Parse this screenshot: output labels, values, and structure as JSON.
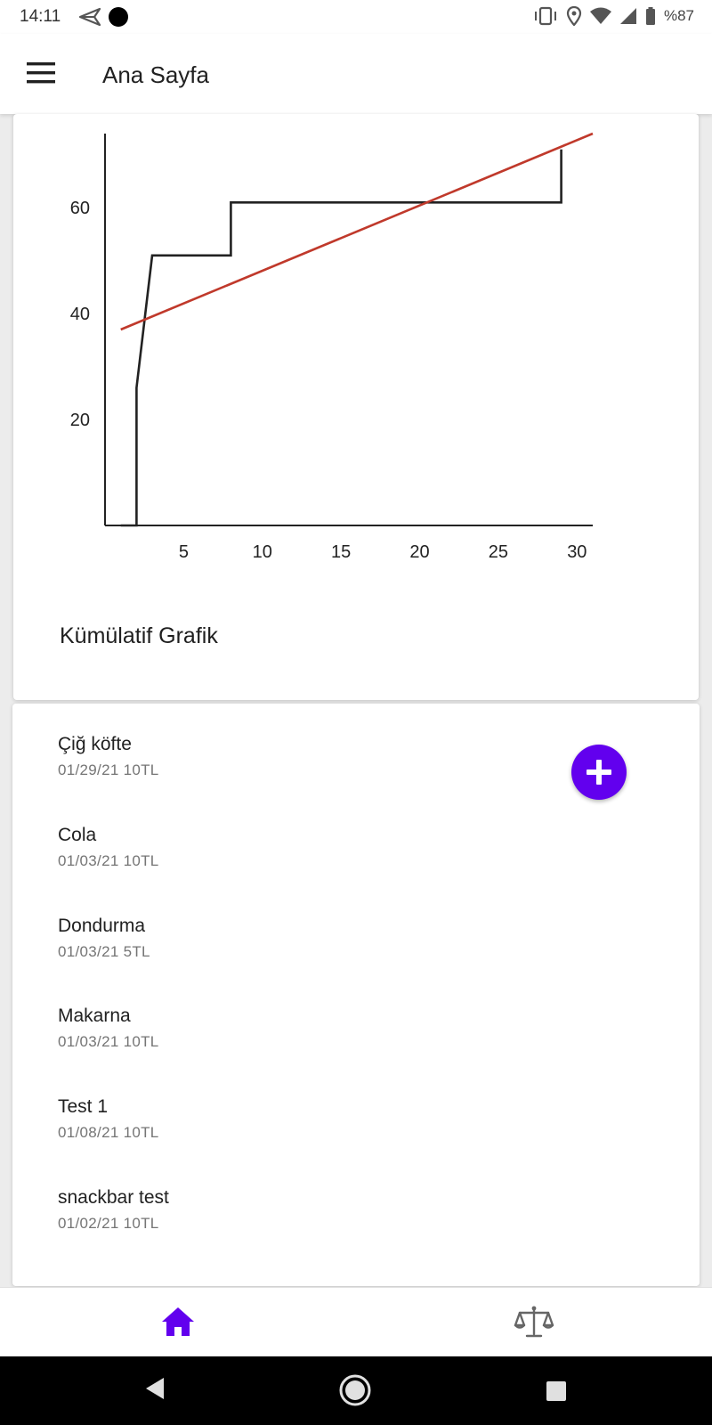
{
  "status_bar": {
    "time": "14:11",
    "battery": "%87",
    "icons": [
      "send-icon",
      "dot-icon",
      "vibrate-icon",
      "location-icon",
      "wifi-icon",
      "signal-icon",
      "battery-icon"
    ]
  },
  "app_bar": {
    "title": "Ana Sayfa",
    "menu_icon": "menu-icon"
  },
  "chart_card": {
    "caption": "Kümülatif Grafik"
  },
  "chart_data": {
    "type": "line",
    "title": "",
    "xlabel": "",
    "ylabel": "",
    "xlim": [
      0,
      31
    ],
    "ylim": [
      0,
      74
    ],
    "x_ticks": [
      5,
      10,
      15,
      20,
      25,
      30
    ],
    "y_ticks": [
      20,
      40,
      60
    ],
    "grid": false,
    "series": [
      {
        "color": "#222222",
        "style": "step",
        "points": [
          [
            1,
            0
          ],
          [
            2,
            0
          ],
          [
            2,
            26
          ],
          [
            3,
            51
          ],
          [
            8,
            51
          ],
          [
            8,
            61
          ],
          [
            29,
            61
          ],
          [
            29,
            71
          ]
        ]
      },
      {
        "color": "#c0392b",
        "style": "trend",
        "points": [
          [
            1,
            37
          ],
          [
            31,
            74
          ]
        ]
      }
    ]
  },
  "items": [
    {
      "name": "Çiğ köfte",
      "detail": "01/29/21 10TL"
    },
    {
      "name": "Cola",
      "detail": "01/03/21 10TL"
    },
    {
      "name": "Dondurma",
      "detail": "01/03/21 5TL"
    },
    {
      "name": "Makarna",
      "detail": "01/03/21 10TL"
    },
    {
      "name": "Test 1",
      "detail": "01/08/21 10TL"
    },
    {
      "name": "snackbar test",
      "detail": "01/02/21 10TL"
    }
  ],
  "fab": {
    "icon": "plus-icon"
  },
  "bottom_nav": {
    "items": [
      {
        "icon": "home-icon",
        "active": true
      },
      {
        "icon": "balance-scale-icon",
        "active": false
      }
    ]
  },
  "colors": {
    "accent": "#6200ee",
    "step_line": "#222222",
    "trend_line": "#c0392b"
  }
}
